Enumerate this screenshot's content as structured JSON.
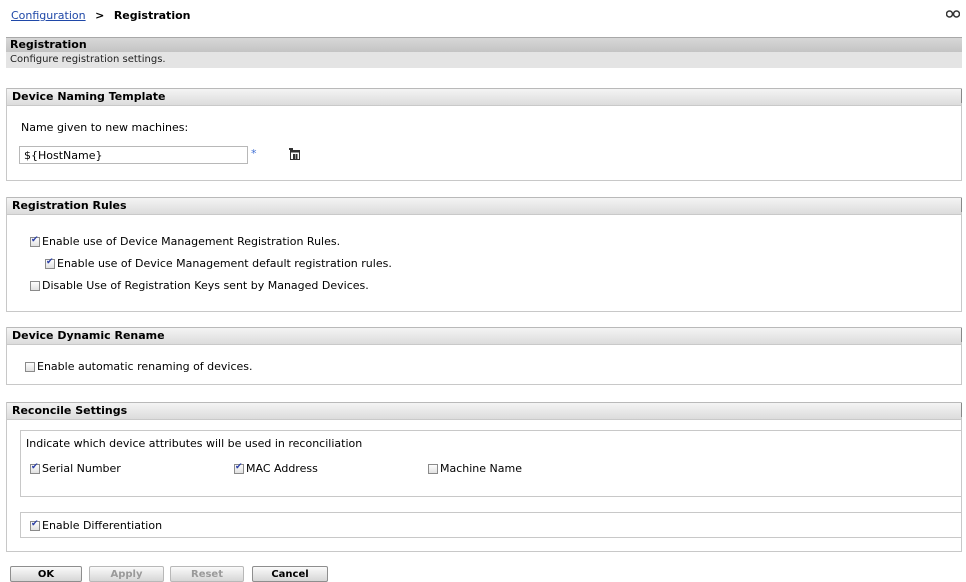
{
  "breadcrumb": {
    "parent": "Configuration",
    "separator": ">",
    "current": "Registration"
  },
  "page": {
    "title": "Registration",
    "description": "Configure registration settings."
  },
  "naming": {
    "header": "Device Naming Template",
    "label": "Name given to new machines:",
    "value": "${HostName}",
    "required_marker": "*"
  },
  "rules": {
    "header": "Registration Rules",
    "items": [
      {
        "label": "Enable use of Device Management Registration Rules.",
        "checked": true
      },
      {
        "label": "Enable use of Device Management default registration rules.",
        "checked": true
      },
      {
        "label": "Disable Use of Registration Keys sent by Managed Devices.",
        "checked": false
      }
    ]
  },
  "rename": {
    "header": "Device Dynamic Rename",
    "items": [
      {
        "label": "Enable automatic renaming of devices.",
        "checked": false
      }
    ]
  },
  "reconcile": {
    "header": "Reconcile Settings",
    "description": "Indicate which device attributes will be used in reconciliation",
    "attributes": [
      {
        "label": "Serial Number",
        "checked": true
      },
      {
        "label": "MAC Address",
        "checked": true
      },
      {
        "label": "Machine Name",
        "checked": false
      }
    ],
    "differentiation": {
      "label": "Enable Differentiation",
      "checked": true
    }
  },
  "buttons": {
    "ok": "OK",
    "apply": "Apply",
    "reset": "Reset",
    "cancel": "Cancel"
  },
  "icons": {
    "help": "help-glasses-icon",
    "browse": "browse-variable-icon"
  },
  "colors": {
    "link": "#1f48a8",
    "required": "#3f6fd4",
    "check": "#2b3fa6"
  }
}
